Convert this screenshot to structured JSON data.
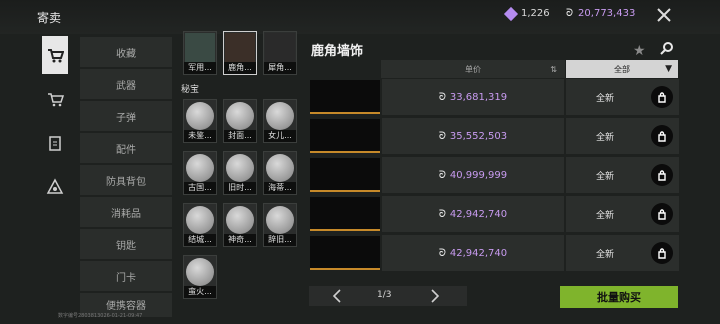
{
  "header": {
    "title": "寄卖",
    "gems": "1,226",
    "coins": "20,773,433"
  },
  "categories": [
    "收藏",
    "武器",
    "子弹",
    "配件",
    "防具背包",
    "消耗品",
    "钥匙",
    "门卡",
    "便携容器"
  ],
  "items": {
    "top_row": [
      "军用...",
      "鹿角...",
      "犀角..."
    ],
    "section_label": "秘宝",
    "treasures": [
      "未鉴...",
      "封面...",
      "女儿...",
      "古国...",
      "旧时...",
      "海蒂...",
      "结城...",
      "神奇...",
      "辞旧...",
      "蛮火..."
    ]
  },
  "listing": {
    "title": "鹿角墙饰",
    "price_header": "单价",
    "filter_label": "全部",
    "rows": [
      {
        "price": "33,681,319",
        "condition": "全新"
      },
      {
        "price": "35,552,503",
        "condition": "全新"
      },
      {
        "price": "40,999,999",
        "condition": "全新"
      },
      {
        "price": "42,942,740",
        "condition": "全新"
      },
      {
        "price": "42,942,740",
        "condition": "全新"
      }
    ],
    "page": "1/3",
    "buy_label": "批量购买"
  },
  "footer": {
    "uid": "数字编号2803813026-01-21-09:47"
  },
  "colors": {
    "accent": "#7fb42c",
    "price": "#c89bf0",
    "gem": "#b58cf0"
  }
}
